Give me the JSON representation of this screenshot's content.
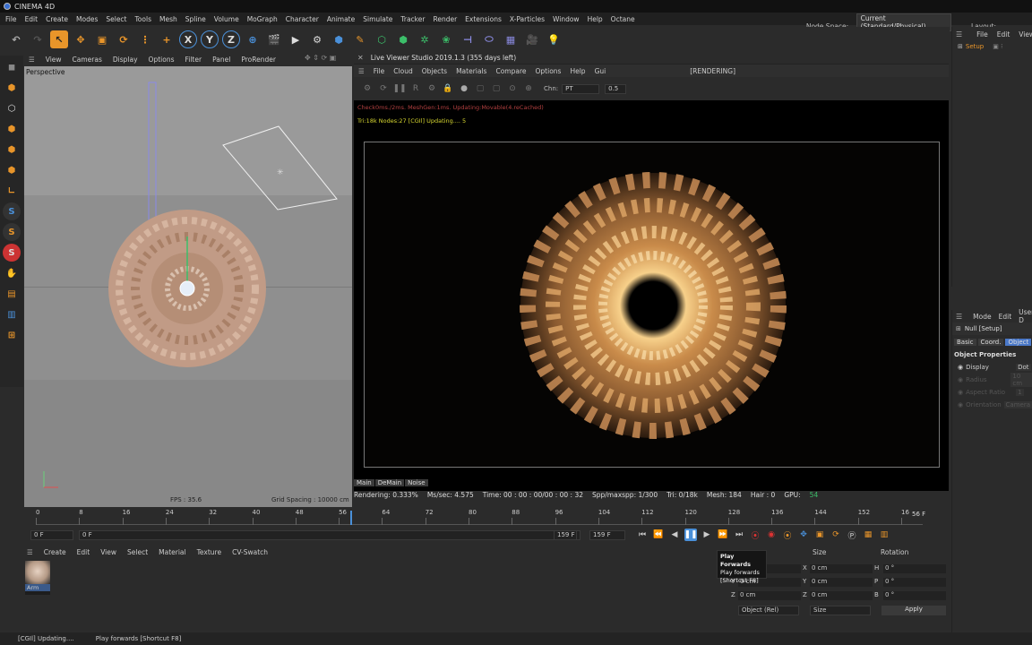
{
  "app": {
    "title": "CINEMA 4D"
  },
  "menubar": [
    "File",
    "Edit",
    "Create",
    "Modes",
    "Select",
    "Tools",
    "Mesh",
    "Spline",
    "Volume",
    "MoGraph",
    "Character",
    "Animate",
    "Simulate",
    "Tracker",
    "Render",
    "Extensions",
    "X-Particles",
    "Window",
    "Help",
    "Octane"
  ],
  "node_space": {
    "label": "Node Space:",
    "value": "Current (Standard/Physical)",
    "layout": "Layout:"
  },
  "viewport": {
    "menu": [
      "View",
      "Cameras",
      "Display",
      "Options",
      "Filter",
      "Panel",
      "ProRender"
    ],
    "label": "Perspective",
    "fps": "FPS : 35.6",
    "grid_spacing": "Grid Spacing : 10000 cm"
  },
  "live_viewer": {
    "title": "Live Viewer Studio 2019.1.3 (355 days left)",
    "menu": [
      "File",
      "Cloud",
      "Objects",
      "Materials",
      "Compare",
      "Options",
      "Help",
      "Gui"
    ],
    "state": "[RENDERING]",
    "channel_label": "Chn:",
    "channel_value": "PT",
    "value_field": "0.5",
    "status_line1": "Check0ms./2ms. MeshGen:1ms. Updating:Movable(4.reCached)",
    "status_line2": "Tri:18k Nodes:27  [CGIl] Updating....   5",
    "tabs": [
      "Main",
      "DeMain",
      "Noise"
    ],
    "render_info": {
      "rendering": "Rendering: 0.333%",
      "ms_sec": "Ms/sec: 4.575",
      "time": "Time: 00 : 00 : 00/00 : 00 : 32",
      "spp": "Spp/maxspp: 1/300",
      "tri": "Tri: 0/18k",
      "mesh": "Mesh: 184",
      "hair": "Hair : 0",
      "gpu_label": "GPU:",
      "gpu_value": "54"
    }
  },
  "timeline": {
    "ticks": [
      "0",
      "8",
      "16",
      "24",
      "32",
      "40",
      "48",
      "56",
      "64",
      "72",
      "80",
      "88",
      "96",
      "104",
      "112",
      "120",
      "128",
      "136",
      "144",
      "152",
      "16"
    ],
    "current_frame_marker": "56 F",
    "start_field": "0 F",
    "start_field2": "0 F",
    "end_field": "159 F",
    "end_field2": "159 F"
  },
  "material_manager": {
    "menu": [
      "Create",
      "Edit",
      "View",
      "Select",
      "Material",
      "Texture",
      "CV-Swatch"
    ],
    "materials": [
      {
        "name": "Arm"
      }
    ]
  },
  "coordinates": {
    "headers": [
      "Size",
      "Rotation"
    ],
    "rows": [
      {
        "pos_label": "X",
        "pos": "0 cm",
        "size_label": "X",
        "size": "0 cm",
        "rot_label": "H",
        "rot": "0 °"
      },
      {
        "pos_label": "Y",
        "pos": "0 cm",
        "size_label": "Y",
        "size": "0 cm",
        "rot_label": "P",
        "rot": "0 °"
      },
      {
        "pos_label": "Z",
        "pos": "0 cm",
        "size_label": "Z",
        "size": "0 cm",
        "rot_label": "B",
        "rot": "0 °"
      }
    ],
    "mode_select": "Object (Rel)",
    "size_select": "Size",
    "apply": "Apply"
  },
  "tooltip": {
    "title": "Play Forwards",
    "line1": "Play forwards",
    "line2": "[Shortcut F8]"
  },
  "object_manager": {
    "menu": [
      "File",
      "Edit",
      "View"
    ],
    "item": "Setup"
  },
  "attributes": {
    "menu": [
      "Mode",
      "Edit",
      "User D"
    ],
    "object": "Null [Setup]",
    "tabs": [
      "Basic",
      "Coord.",
      "Object"
    ],
    "section": "Object Properties",
    "props": [
      {
        "label": "Display",
        "value": "Dot"
      },
      {
        "label": "Radius",
        "value": "10 cm"
      },
      {
        "label": "Aspect Ratio",
        "value": "1"
      },
      {
        "label": "Orientation",
        "value": "Camera"
      }
    ]
  },
  "statusbar": {
    "left": "[CGIl] Updating....",
    "right": "Play forwards [Shortcut F8]"
  },
  "colors": {
    "accent_orange": "#e8952a",
    "accent_blue": "#4a90d9",
    "render_status_red": "#b34040",
    "render_status_yellow": "#d8d830"
  }
}
